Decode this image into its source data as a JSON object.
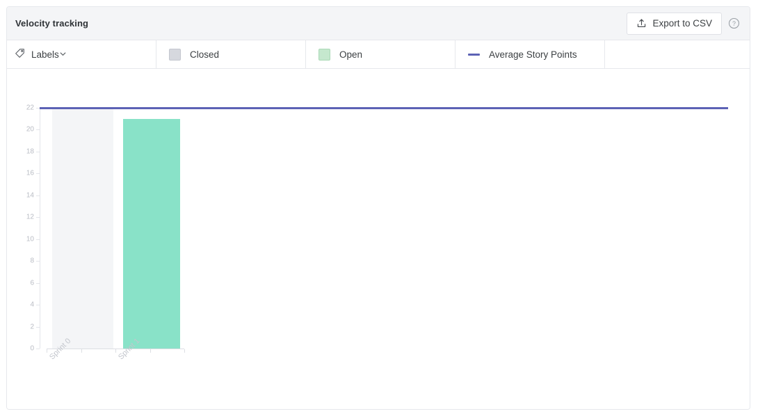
{
  "header": {
    "title": "Velocity tracking",
    "export_label": "Export to CSV",
    "export_icon": "export-upload-icon",
    "help_icon": "help-circle-icon"
  },
  "legend": {
    "labels_filter": {
      "icon": "tag-icon",
      "label": "Labels",
      "chevron_icon": "chevron-down-icon"
    },
    "items": [
      {
        "label": "Closed",
        "color": "#d6d8de",
        "marker": "square"
      },
      {
        "label": "Open",
        "color": "#c5e8ce",
        "marker": "square"
      },
      {
        "label": "Average Story Points",
        "color": "#5c62b5",
        "marker": "line"
      }
    ]
  },
  "chart_data": {
    "type": "bar",
    "title": "Velocity tracking",
    "xlabel": "",
    "ylabel": "",
    "categories": [
      "Sprint 0",
      "Sprint 1"
    ],
    "series": [
      {
        "name": "Closed",
        "color": "#d6d8de",
        "values": [
          0,
          0
        ]
      },
      {
        "name": "Open",
        "color": "#89e2c8",
        "values": [
          0,
          21
        ]
      }
    ],
    "reference_line": {
      "name": "Average Story Points",
      "value": 22,
      "color": "#5c62b5"
    },
    "ylim": [
      0,
      22
    ],
    "ytick_values": [
      0,
      2,
      4,
      6,
      8,
      10,
      12,
      14,
      16,
      18,
      20,
      22
    ],
    "grid": false,
    "legend_position": "top",
    "hovered_category": "Sprint 0"
  },
  "colors": {
    "card_border": "#e6e8ec",
    "header_bg": "#f4f5f7",
    "bar_open": "#89e2c8",
    "avg_line": "#5c62b5",
    "hover_band": "#f4f5f7",
    "axis": "#dcdee3",
    "tick_text": "#b9bcc4"
  }
}
